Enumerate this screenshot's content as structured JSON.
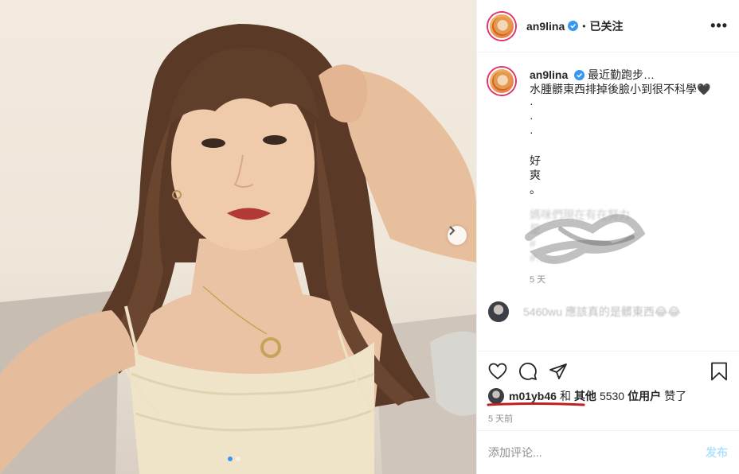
{
  "post": {
    "username": "an9lina",
    "separator": "•",
    "follow_label": "已关注",
    "more_label": "•••",
    "next_icon": "chevron-right-icon"
  },
  "caption": {
    "username": "an9lina",
    "lines": [
      "最近勤跑步…",
      "水腫髒東西排掉後臉小到很不科學🖤",
      "·",
      "·",
      "·",
      "",
      "好",
      "爽",
      "。"
    ],
    "blurred_lines": [
      "媽咪們現在有在努力",
      "是",
      "#",
      "#……"
    ],
    "time": "5 天"
  },
  "reply": {
    "username": "5460wu",
    "text": "應該真的是髒東西😂😂"
  },
  "likes": {
    "user": "m01yb46",
    "and": "和",
    "others": "其他",
    "count": "5530",
    "suffix": "位用户",
    "verb": "赞了"
  },
  "posted": "5 天前",
  "comment_box": {
    "placeholder": "添加评论...",
    "post_label": "发布"
  },
  "colors": {
    "verified": "#3897f0",
    "post_button_disabled": "#b2dffc",
    "annotation_underline": "#c0201d",
    "story_ring": "#e1306c"
  }
}
